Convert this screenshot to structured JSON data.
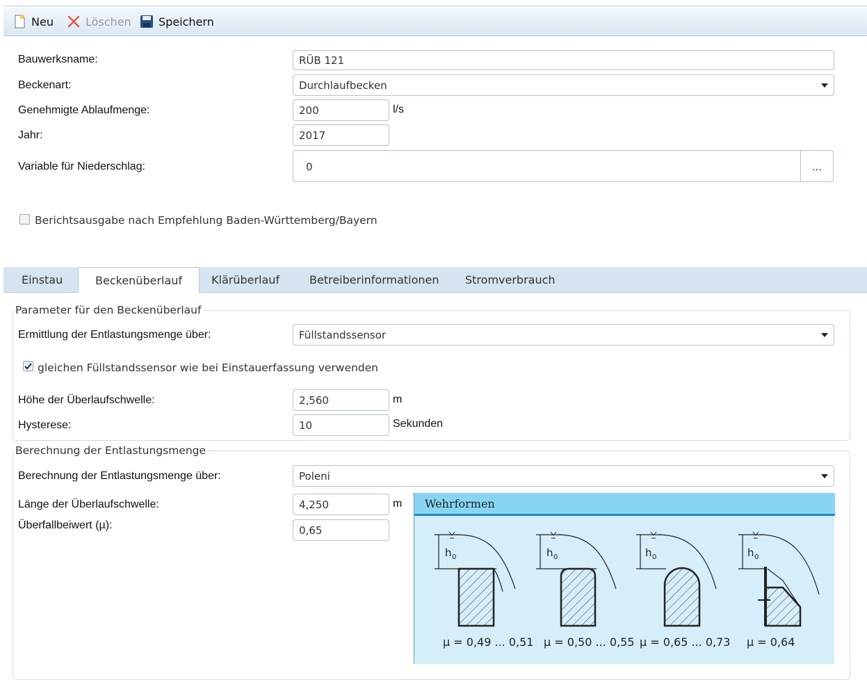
{
  "toolbar": {
    "new_label": "Neu",
    "delete_label": "Löschen",
    "save_label": "Speichern"
  },
  "form": {
    "bauwerksname": {
      "label": "Bauwerksname:",
      "value": "RÜB 121"
    },
    "beckenart": {
      "label": "Beckenart:",
      "value": "Durchlaufbecken"
    },
    "ablaufmenge": {
      "label": "Genehmigte Ablaufmenge:",
      "value": "200",
      "unit": "l/s"
    },
    "jahr": {
      "label": "Jahr:",
      "value": "2017"
    },
    "niederschlag": {
      "label": "Variable für Niederschlag:",
      "value": "0",
      "button": "..."
    },
    "bericht_checkbox": {
      "label": "Berichtsausgabe nach Empfehlung Baden-Württemberg/Bayern",
      "checked": false
    }
  },
  "tabs": [
    {
      "label": "Einstau"
    },
    {
      "label": "Beckenüberlauf",
      "active": true
    },
    {
      "label": "Klärüberlauf"
    },
    {
      "label": "Betreiberinformationen"
    },
    {
      "label": "Stromverbrauch"
    }
  ],
  "parameter_group": {
    "title": "Parameter für den Beckenüberlauf",
    "ermittlung": {
      "label": "Ermittlung der Entlastungsmenge über:",
      "value": "Füllstandssensor"
    },
    "sensor_checkbox": {
      "label": "gleichen Füllstandssensor wie bei Einstauerfassung verwenden",
      "checked": true
    },
    "hoehe": {
      "label": "Höhe der Überlaufschwelle:",
      "value": "2,560",
      "unit": "m"
    },
    "hysterese": {
      "label": "Hysterese:",
      "value": "10",
      "unit": "Sekunden"
    }
  },
  "berechnung_group": {
    "title": "Berechnung der Entlastungsmenge",
    "methode": {
      "label": "Berechnung der Entlastungsmenge über:",
      "value": "Poleni"
    },
    "laenge": {
      "label": "Länge der Überlaufschwelle:",
      "value": "4,250",
      "unit": "m"
    },
    "beiwert": {
      "label": "Überfallbeiwert (µ):",
      "value": "0,65"
    }
  },
  "wehrformen": {
    "title": "Wehrformen",
    "h_label": "h",
    "h_sub": "0",
    "shapes": [
      {
        "mu": "µ = 0,49 ... 0,51"
      },
      {
        "mu": "µ = 0,50 ... 0,55"
      },
      {
        "mu": "µ = 0,65 ... 0,73"
      },
      {
        "mu": "µ = 0,64"
      }
    ]
  },
  "colors": {
    "toolbar_bg": "#dbe7f2",
    "tabbar_bg": "#d6e4f1",
    "wehr_header": "#88d5f3",
    "wehr_body": "#d5eef9",
    "delete_icon": "#e0564f",
    "save_icon": "#2a4f7f"
  }
}
